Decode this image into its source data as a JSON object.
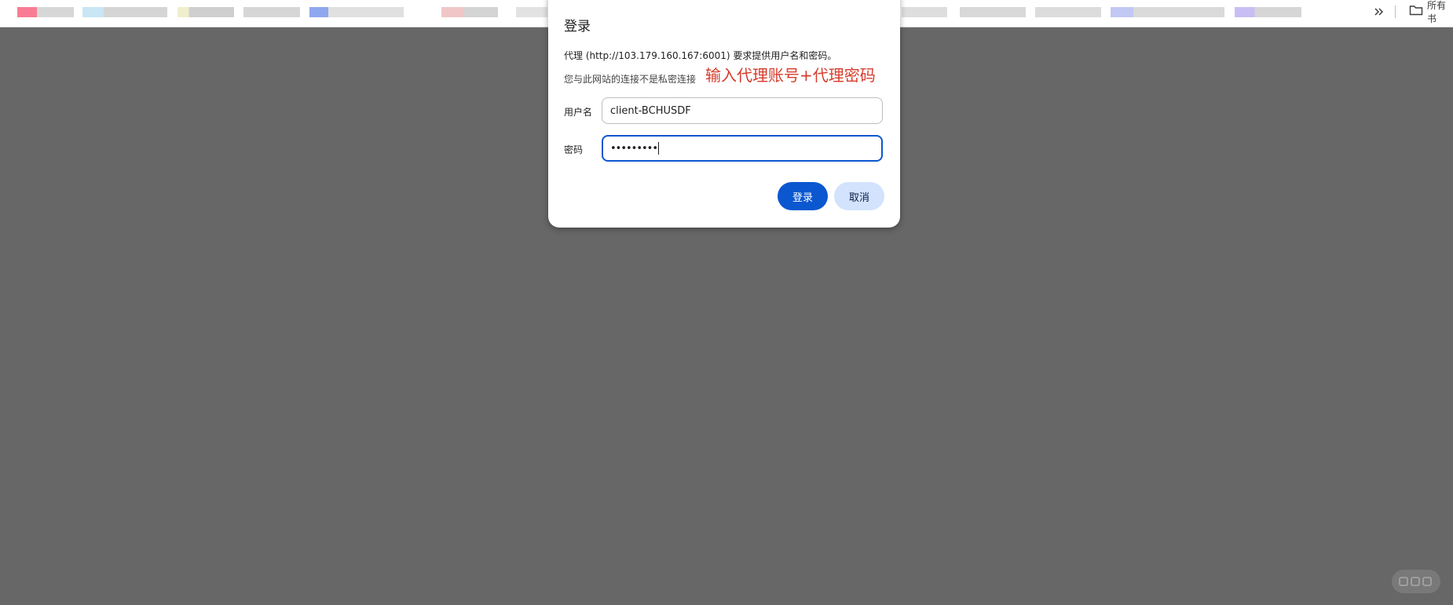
{
  "bookmarks_bar": {
    "overflow_icon": "double-chevron-right",
    "folder_icon": "folder",
    "folder_label": "所有书"
  },
  "dialog": {
    "title": "登录",
    "proxy_message": "代理 (http://103.179.160.167:6001) 要求提供用户名和密码。",
    "secure_notice": "您与此网站的连接不是私密连接",
    "annotation": "输入代理账号+代理密码",
    "username": {
      "label": "用户名",
      "value": "client-BCHUSDF"
    },
    "password": {
      "label": "密码",
      "masked_value": "•••••••••"
    },
    "login_button": "登录",
    "cancel_button": "取消"
  },
  "colors": {
    "backdrop": "#676767",
    "primary_button": "#0b57d0",
    "secondary_button": "#d3e3fd",
    "annotation": "#d63c2c"
  }
}
